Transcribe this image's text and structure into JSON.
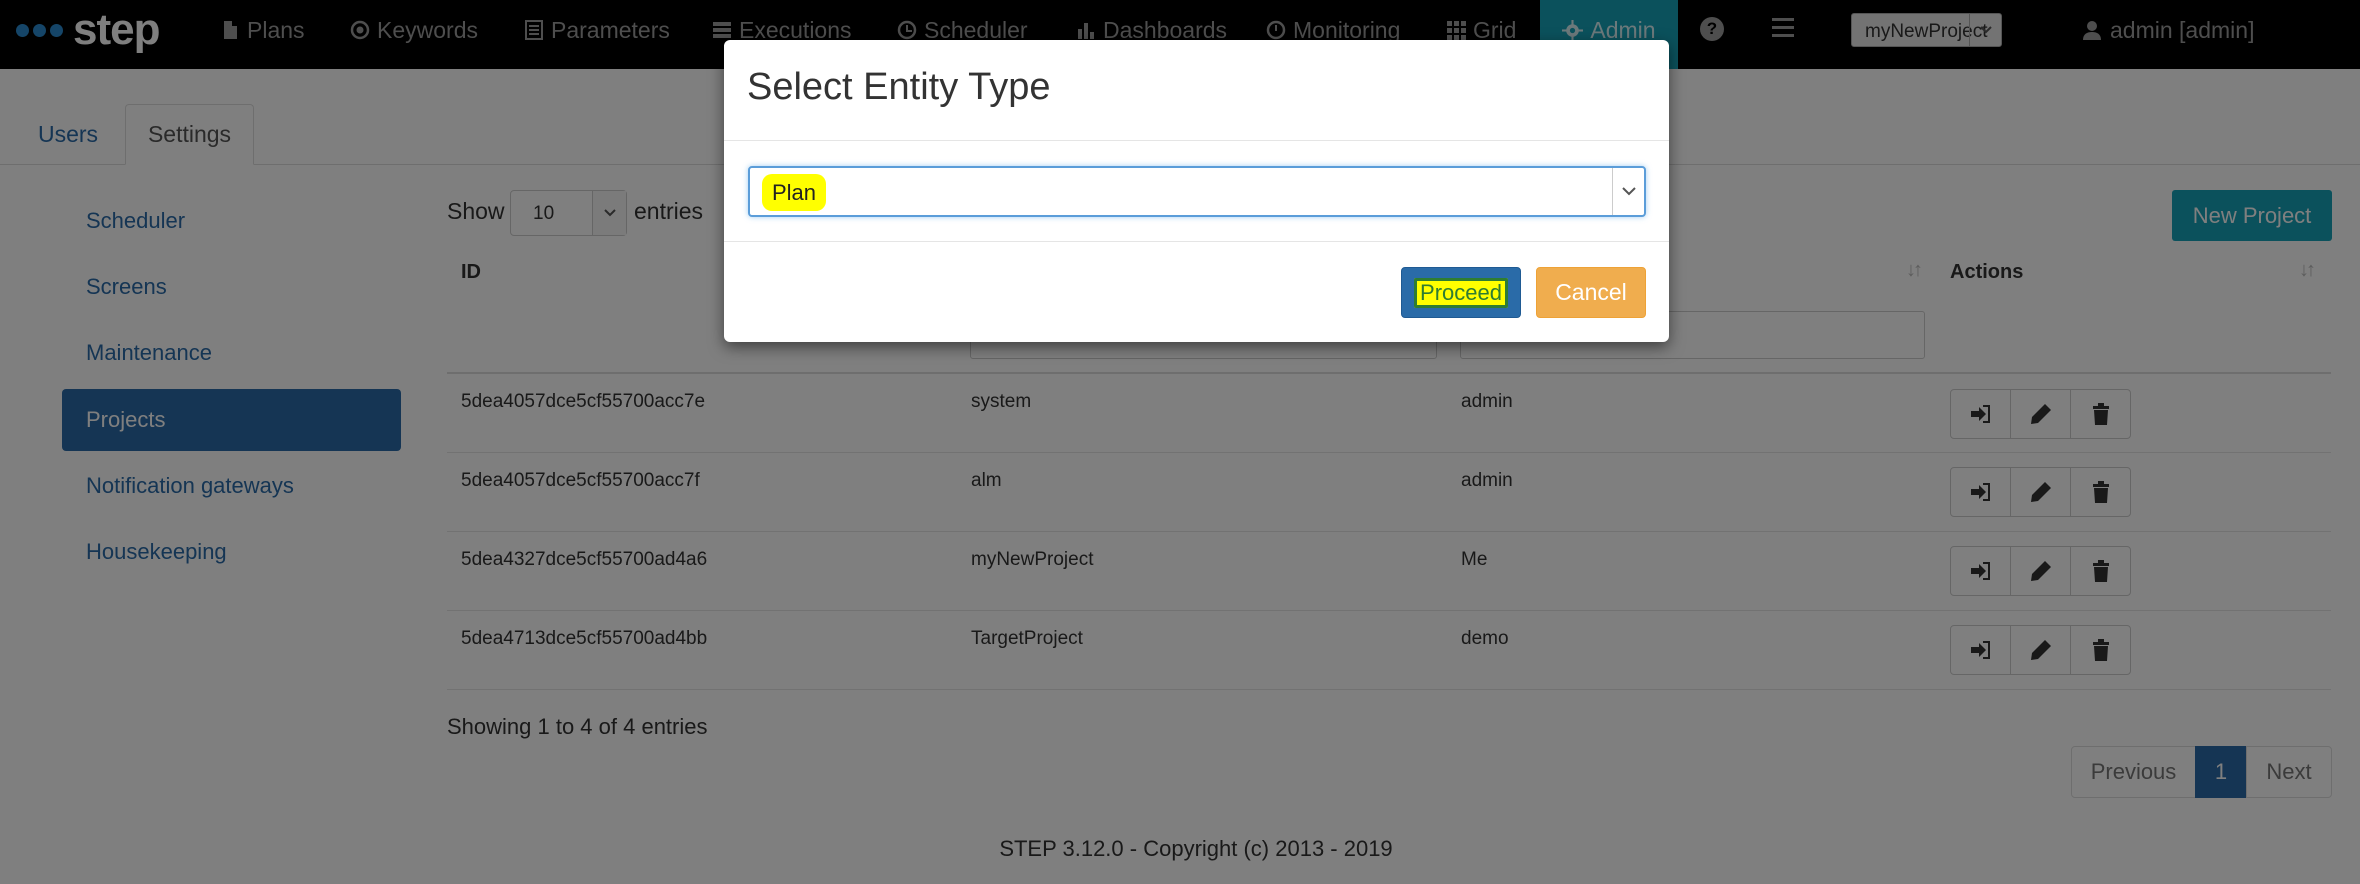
{
  "nav": {
    "brand": "step",
    "items": [
      {
        "label": "Plans",
        "icon": "file-icon"
      },
      {
        "label": "Keywords",
        "icon": "target-icon"
      },
      {
        "label": "Parameters",
        "icon": "list-icon"
      },
      {
        "label": "Executions",
        "icon": "tasks-icon"
      },
      {
        "label": "Scheduler",
        "icon": "clock-icon"
      },
      {
        "label": "Dashboards",
        "icon": "bar-chart-icon"
      },
      {
        "label": "Monitoring",
        "icon": "dashboard-icon"
      },
      {
        "label": "Grid",
        "icon": "grid-icon"
      }
    ],
    "active": {
      "label": "Admin",
      "icon": "gear-icon"
    },
    "help_glyph": "?",
    "project": "myNewProject",
    "user": "admin [admin]"
  },
  "tabs": {
    "users": "Users",
    "settings": "Settings"
  },
  "sidebar": {
    "items": [
      {
        "label": "Scheduler"
      },
      {
        "label": "Screens"
      },
      {
        "label": "Maintenance"
      },
      {
        "label": "Projects"
      },
      {
        "label": "Notification gateways"
      },
      {
        "label": "Housekeeping"
      }
    ],
    "active_index": 3
  },
  "table": {
    "show_label": "Show",
    "length": "10",
    "entries_label": "entries",
    "new_project": "New Project",
    "columns": {
      "id": "ID",
      "actions": "Actions"
    },
    "rows": [
      {
        "id": "5dea4057dce5cf55700acc7e",
        "name": "system",
        "owner": "admin"
      },
      {
        "id": "5dea4057dce5cf55700acc7f",
        "name": "alm",
        "owner": "admin"
      },
      {
        "id": "5dea4327dce5cf55700ad4a6",
        "name": "myNewProject",
        "owner": "Me"
      },
      {
        "id": "5dea4713dce5cf55700ad4bb",
        "name": "TargetProject",
        "owner": "demo"
      }
    ],
    "info": "Showing 1 to 4 of 4 entries",
    "pagination": {
      "previous": "Previous",
      "current": "1",
      "next": "Next"
    }
  },
  "footer": "STEP 3.12.0 - Copyright (c) 2013 - 2019",
  "modal": {
    "title": "Select Entity Type",
    "selected": "Plan",
    "proceed": "Proceed",
    "cancel": "Cancel"
  },
  "colors": {
    "accent": "#17a2b8",
    "primary": "#2a6ba8",
    "warning": "#f0ad4e",
    "highlight": "#ffff00"
  }
}
